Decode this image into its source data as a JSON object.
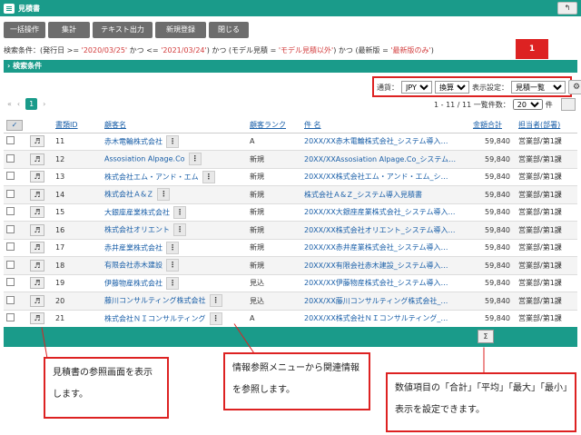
{
  "window": {
    "title": "見積書",
    "corner_icon": "↰"
  },
  "toolbar": [
    "一括操作",
    "集計",
    "テキスト出力",
    "新規登録",
    "閉じる"
  ],
  "condition": {
    "prefix": "検索条件：(発行日 >= ",
    "from": "'2020/03/25'",
    "mid": " かつ <= ",
    "to": "'2021/03/24'",
    "mid2": ") かつ (モデル見積 = ",
    "model": "'モデル見積以外'",
    "mid3": ") かつ (最新版 = ",
    "latest": "'最新版のみ'",
    "suffix": ")"
  },
  "section": {
    "label": "› 検索条件"
  },
  "settings": {
    "currency_label": "通貨：",
    "currency": "JPY",
    "convert": "換算",
    "display_label": "表示設定：",
    "display": "見積一覧"
  },
  "badge": "1",
  "pager": {
    "first": "«",
    "prev": "‹",
    "current": "1",
    "next": "›",
    "info": "1 - 11 / 11 一覧件数：",
    "per_page": "20",
    "unit": "件"
  },
  "table": {
    "headers": [
      "書類ID",
      "顧客名",
      "顧客ランク",
      "件 名",
      "金額合計",
      "担当者(部署)"
    ],
    "rows": [
      [
        "11",
        "赤木電輪株式会社",
        "A",
        "20XX/XX赤木電輪株式会社_システム導入…",
        "59,840",
        "営業部/第1課"
      ],
      [
        "12",
        "Assosiation Alpage.Co",
        "新規",
        "20XX/XXAssosiation Alpage.Co_システム…",
        "59,840",
        "営業部/第1課"
      ],
      [
        "13",
        "株式会社エム・アンド・エム",
        "新規",
        "20XX/XX株式会社エム・アンド・エム_シ…",
        "59,840",
        "営業部/第1課"
      ],
      [
        "14",
        "株式会社Ａ&Ｚ",
        "新規",
        "株式会社Ａ&Ｚ_システム導入見積書",
        "59,840",
        "営業部/第1課"
      ],
      [
        "15",
        "大銀座産業株式会社",
        "新規",
        "20XX/XX大銀座産業株式会社_システム導入…",
        "59,840",
        "営業部/第1課"
      ],
      [
        "16",
        "株式会社オリエント",
        "新規",
        "20XX/XX株式会社オリエント_システム導入…",
        "59,840",
        "営業部/第1課"
      ],
      [
        "17",
        "赤井産業株式会社",
        "新規",
        "20XX/XX赤井産業株式会社_システム導入…",
        "59,840",
        "営業部/第1課"
      ],
      [
        "18",
        "有限会社赤木建設",
        "新規",
        "20XX/XX有限会社赤木建設_システム導入…",
        "59,840",
        "営業部/第1課"
      ],
      [
        "19",
        "伊藤物産株式会社",
        "見込",
        "20XX/XX伊藤物産株式会社_システム導入…",
        "59,840",
        "営業部/第1課"
      ],
      [
        "20",
        "藤川コンサルティング株式会社",
        "見込",
        "20XX/XX藤川コンサルティング株式会社_…",
        "59,840",
        "営業部/第1課"
      ],
      [
        "21",
        "株式会社ＮＩコンサルティング",
        "A",
        "20XX/XX株式会社ＮＩコンサルティング_…",
        "59,840",
        "営業部/第1課"
      ]
    ]
  },
  "footer": {
    "sum_icon": "Σ"
  },
  "callouts": {
    "c1": "見積書の参照画面を表示します。",
    "c2": "情報参照メニューから関連情報を参照します。",
    "c3": "数値項目の「合計」「平均」「最大」「最小」表示を設定できます。"
  }
}
